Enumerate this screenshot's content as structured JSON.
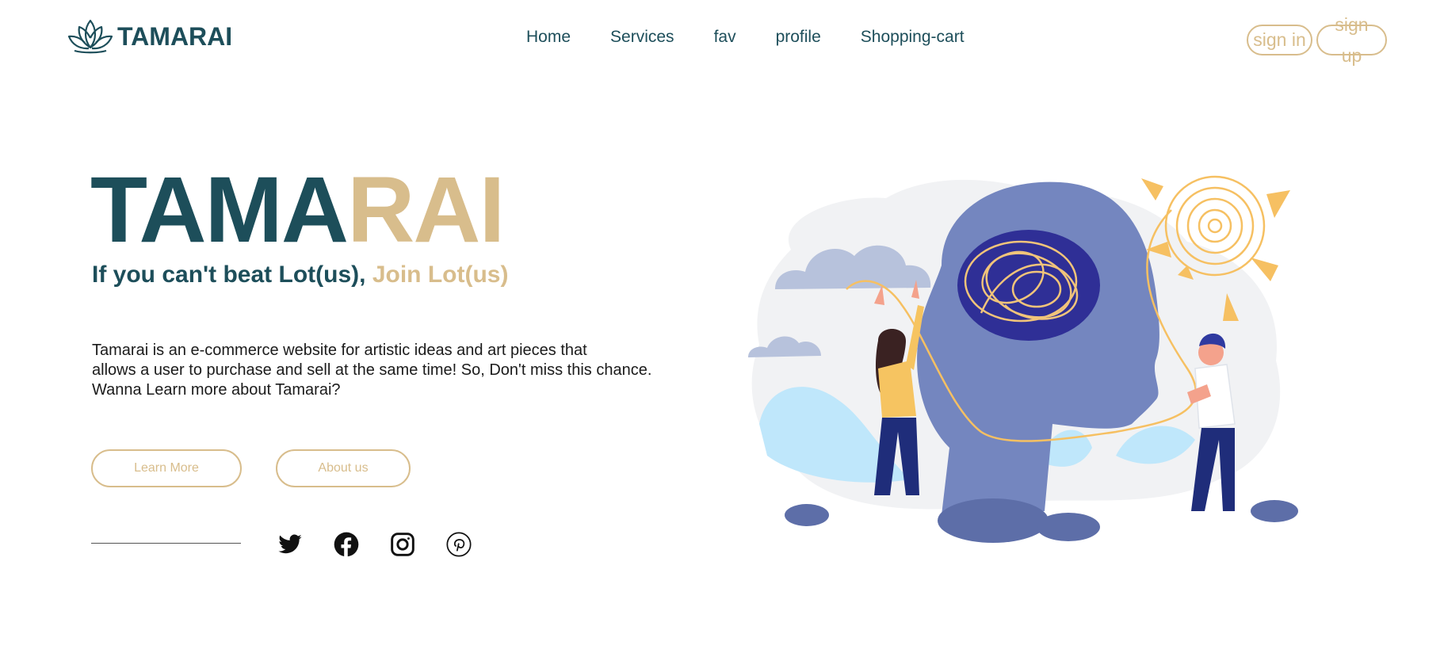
{
  "brand": {
    "name": "TAMARAI",
    "logo_icon": "lotus-icon",
    "colors": {
      "primary": "#1d4e5a",
      "accent": "#d8bd8c"
    }
  },
  "nav": {
    "items": [
      {
        "label": "Home"
      },
      {
        "label": "Services"
      },
      {
        "label": "fav"
      },
      {
        "label": "profile"
      },
      {
        "label": "Shopping-cart"
      }
    ]
  },
  "auth": {
    "sign_in_label": "sign in",
    "sign_up_label": "sign up"
  },
  "hero": {
    "title_part1": "TAMA",
    "title_part2": "RAI",
    "tagline_part1": "If you can't beat Lot(us), ",
    "tagline_part2": "Join Lot(us)",
    "description_lines": [
      "Tamarai is an e-commerce website for artistic ideas and art pieces that",
      "allows a user to purchase and sell at the same time! So, Don't miss this chance.",
      "Wanna Learn more about Tamarai?"
    ],
    "learn_more_label": "Learn More",
    "about_us_label": "About us",
    "illustration_icon": "creative-mind-illustration"
  },
  "social": [
    {
      "icon": "twitter-icon"
    },
    {
      "icon": "facebook-icon"
    },
    {
      "icon": "instagram-icon"
    },
    {
      "icon": "pinterest-icon"
    }
  ]
}
